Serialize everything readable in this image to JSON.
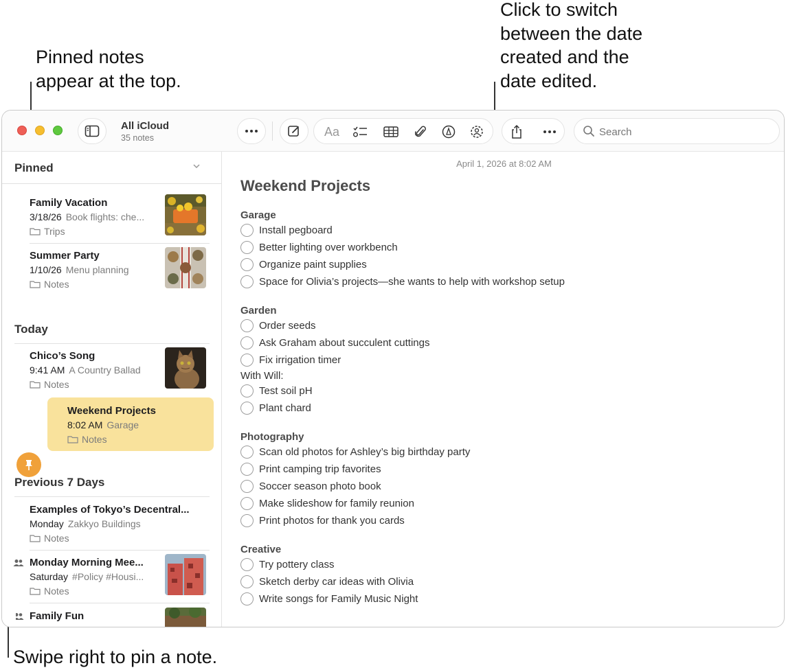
{
  "callouts": {
    "pinned": "Pinned notes\nappear at the top.",
    "date_toggle": "Click to switch\nbetween the date\ncreated and the\ndate edited.",
    "swipe": "Swipe right to pin a note."
  },
  "toolbar": {
    "account_title": "All iCloud",
    "account_subtitle": "35 notes",
    "format_label": "Aa",
    "search_placeholder": "Search",
    "icons": [
      "sidebar-toggle-icon",
      "more-icon",
      "compose-icon",
      "format-icon",
      "checklist-icon",
      "table-icon",
      "attachment-icon",
      "markup-icon",
      "collaborate-icon",
      "share-icon",
      "more-icon",
      "search-icon"
    ]
  },
  "sidebar": {
    "pinned_header": "Pinned",
    "today_header": "Today",
    "previous_header": "Previous 7 Days",
    "pinned": [
      {
        "title": "Family Vacation",
        "date": "3/18/26",
        "preview": "Book flights: che...",
        "folder": "Trips"
      },
      {
        "title": "Summer Party",
        "date": "1/10/26",
        "preview": "Menu planning",
        "folder": "Notes"
      }
    ],
    "today": [
      {
        "title": "Chico’s Song",
        "date": "9:41 AM",
        "preview": "A Country Ballad",
        "folder": "Notes"
      },
      {
        "title": "Weekend Projects",
        "date": "8:02 AM",
        "preview": "Garage",
        "folder": "Notes"
      }
    ],
    "previous": [
      {
        "title": "Examples of Tokyo’s Decentral...",
        "date": "Monday",
        "preview": "Zakkyo Buildings",
        "folder": "Notes"
      },
      {
        "title": "Monday Morning Mee...",
        "date": "Saturday",
        "preview": "#Policy #Housi...",
        "folder": "Notes"
      },
      {
        "title": "Family Fun",
        "date": "",
        "preview": "",
        "folder": ""
      }
    ]
  },
  "editor": {
    "date": "April 1, 2026 at 8:02 AM",
    "title": "Weekend Projects",
    "garage": {
      "heading": "Garage",
      "items": [
        "Install pegboard",
        "Better lighting over workbench",
        "Organize paint supplies",
        "Space for Olivia’s projects—she wants to help with workshop setup"
      ]
    },
    "garden": {
      "heading": "Garden",
      "items": [
        "Order seeds",
        "Ask Graham about succulent cuttings",
        "Fix irrigation timer"
      ],
      "subheading": "With Will:",
      "sub_items": [
        "Test soil pH",
        "Plant chard"
      ]
    },
    "photography": {
      "heading": "Photography",
      "items": [
        "Scan old photos for Ashley’s big birthday party",
        "Print camping trip favorites",
        "Soccer season photo book",
        "Make slideshow for family reunion",
        "Print photos for thank you cards"
      ]
    },
    "creative": {
      "heading": "Creative",
      "items": [
        "Try pottery class",
        "Sketch derby car ideas with Olivia",
        "Write songs for Family Music Night"
      ]
    }
  },
  "colors": {
    "selected_note": "#f9e29c",
    "pin_button": "#f0a13a",
    "close": "#ee5f57",
    "minimize": "#f6be2f",
    "zoom": "#5fc83f"
  }
}
